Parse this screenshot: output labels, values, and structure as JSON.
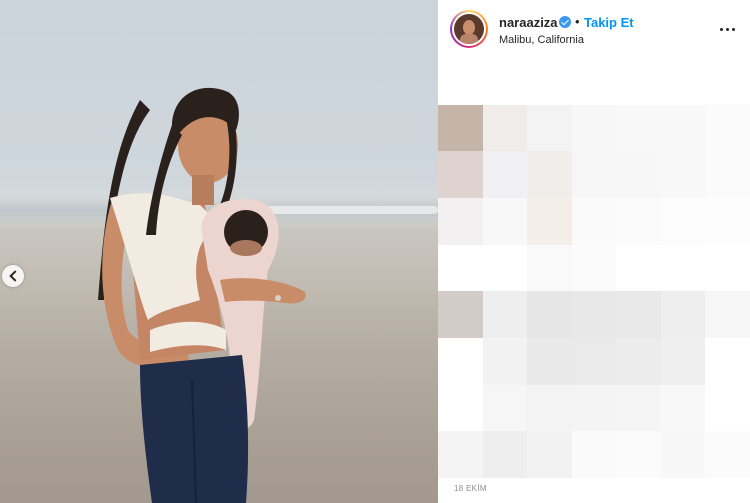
{
  "post": {
    "username": "naraaziza",
    "separator": "•",
    "follow_label": "Takip Et",
    "location": "Malibu, California",
    "date": "18 EKİM",
    "verified": true
  },
  "icons": {
    "verified": "verified-badge-icon",
    "more": "more-horizontal-icon",
    "carousel_prev": "chevron-left-icon"
  },
  "colors": {
    "follow": "#0095f6",
    "verified": "#3897f0",
    "text": "#262626",
    "muted": "#8e8e8e"
  },
  "mosaic": {
    "cols": 7,
    "rows": 9,
    "cells": [
      "#ffffff",
      "#ffffff",
      "#ffffff",
      "#ffffff",
      "#ffffff",
      "#ffffff",
      "#ffffff",
      "#c5b5a9",
      "#f1ecec",
      "#f3f3f4",
      "#f7f7f8",
      "#f8f8f9",
      "#f8f8f8",
      "#fbfbfb",
      "#ded3cf",
      "#f0eff2",
      "#f0eeeb",
      "#f6f6f6",
      "#f7f7f8",
      "#f8f8f8",
      "#fbfbfb",
      "#f2f0f1",
      "#f8f8f8",
      "#f3efe8",
      "#fafafa",
      "#fbfbfb",
      "#fcfcfc",
      "#fdfdfd",
      "#ffffff",
      "#ffffff",
      "#f9f9f9",
      "#fbfbfb",
      "#ffffff",
      "#ffffff",
      "#ffffff",
      "#d3cbc8",
      "#eeeeee",
      "#e6e6e6",
      "#e8e8e8",
      "#e9e9e9",
      "#eeeeee",
      "#f6f6f6",
      "#ffffff",
      "#f2f2f2",
      "#e9e9e9",
      "#eaeaea",
      "#ececec",
      "#efefef",
      "#ffffff",
      "#ffffff",
      "#f6f6f6",
      "#f3f3f3",
      "#f4f4f4",
      "#f5f5f5",
      "#f8f8f8",
      "#ffffff",
      "#f4f4f4",
      "#eeeeee",
      "#f2f2f2",
      "#fafafa",
      "#fbfbfb",
      "#f7f7f7",
      "#fbfbfb"
    ]
  }
}
